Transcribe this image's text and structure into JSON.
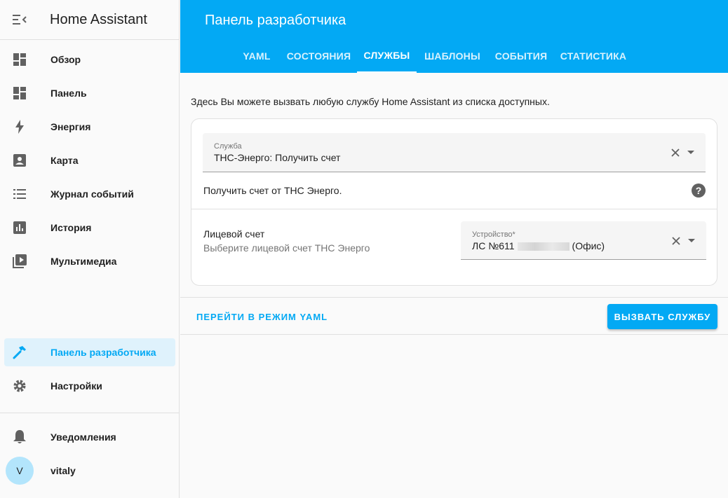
{
  "app": {
    "title": "Home Assistant"
  },
  "sidebar": {
    "items": [
      {
        "label": "Обзор",
        "icon": "dashboard-icon"
      },
      {
        "label": "Панель",
        "icon": "dashboard-icon"
      },
      {
        "label": "Энергия",
        "icon": "lightning-icon"
      },
      {
        "label": "Карта",
        "icon": "account-box-icon"
      },
      {
        "label": "Журнал событий",
        "icon": "list-icon"
      },
      {
        "label": "История",
        "icon": "chart-box-icon"
      },
      {
        "label": "Мультимедиа",
        "icon": "play-box-icon"
      }
    ],
    "developer": {
      "label": "Панель разработчика",
      "icon": "hammer-icon"
    },
    "settings": {
      "label": "Настройки",
      "icon": "cog-icon"
    },
    "notifications": {
      "label": "Уведомления",
      "icon": "bell-icon"
    },
    "user": {
      "label": "vitaly",
      "avatar_letter": "V"
    }
  },
  "header": {
    "title": "Панель разработчика",
    "tabs": [
      {
        "label": "YAML"
      },
      {
        "label": "СОСТОЯНИЯ"
      },
      {
        "label": "СЛУЖБЫ",
        "active": true
      },
      {
        "label": "ШАБЛОНЫ"
      },
      {
        "label": "СОБЫТИЯ"
      },
      {
        "label": "СТАТИСТИКА"
      }
    ]
  },
  "content": {
    "description": "Здесь Вы можете вызвать любую службу Home Assistant из списка доступных.",
    "service_field": {
      "label": "Служба",
      "value": "ТНС-Энерго: Получить счет"
    },
    "service_description": "Получить счет от ТНС Энерго.",
    "help_icon_text": "?",
    "parameter": {
      "name": "Лицевой счет",
      "description": "Выберите лицевой счет ТНС Энерго"
    },
    "device_field": {
      "label": "Устройство*",
      "value_prefix": "ЛС №611",
      "value_suffix": "(Офис)"
    }
  },
  "footer": {
    "yaml_mode": "ПЕРЕЙТИ В РЕЖИМ YAML",
    "call_service": "ВЫЗВАТЬ СЛУЖБУ"
  },
  "colors": {
    "primary": "#03a9f4",
    "active_bg": "#dff2fc",
    "icon": "#616161"
  }
}
